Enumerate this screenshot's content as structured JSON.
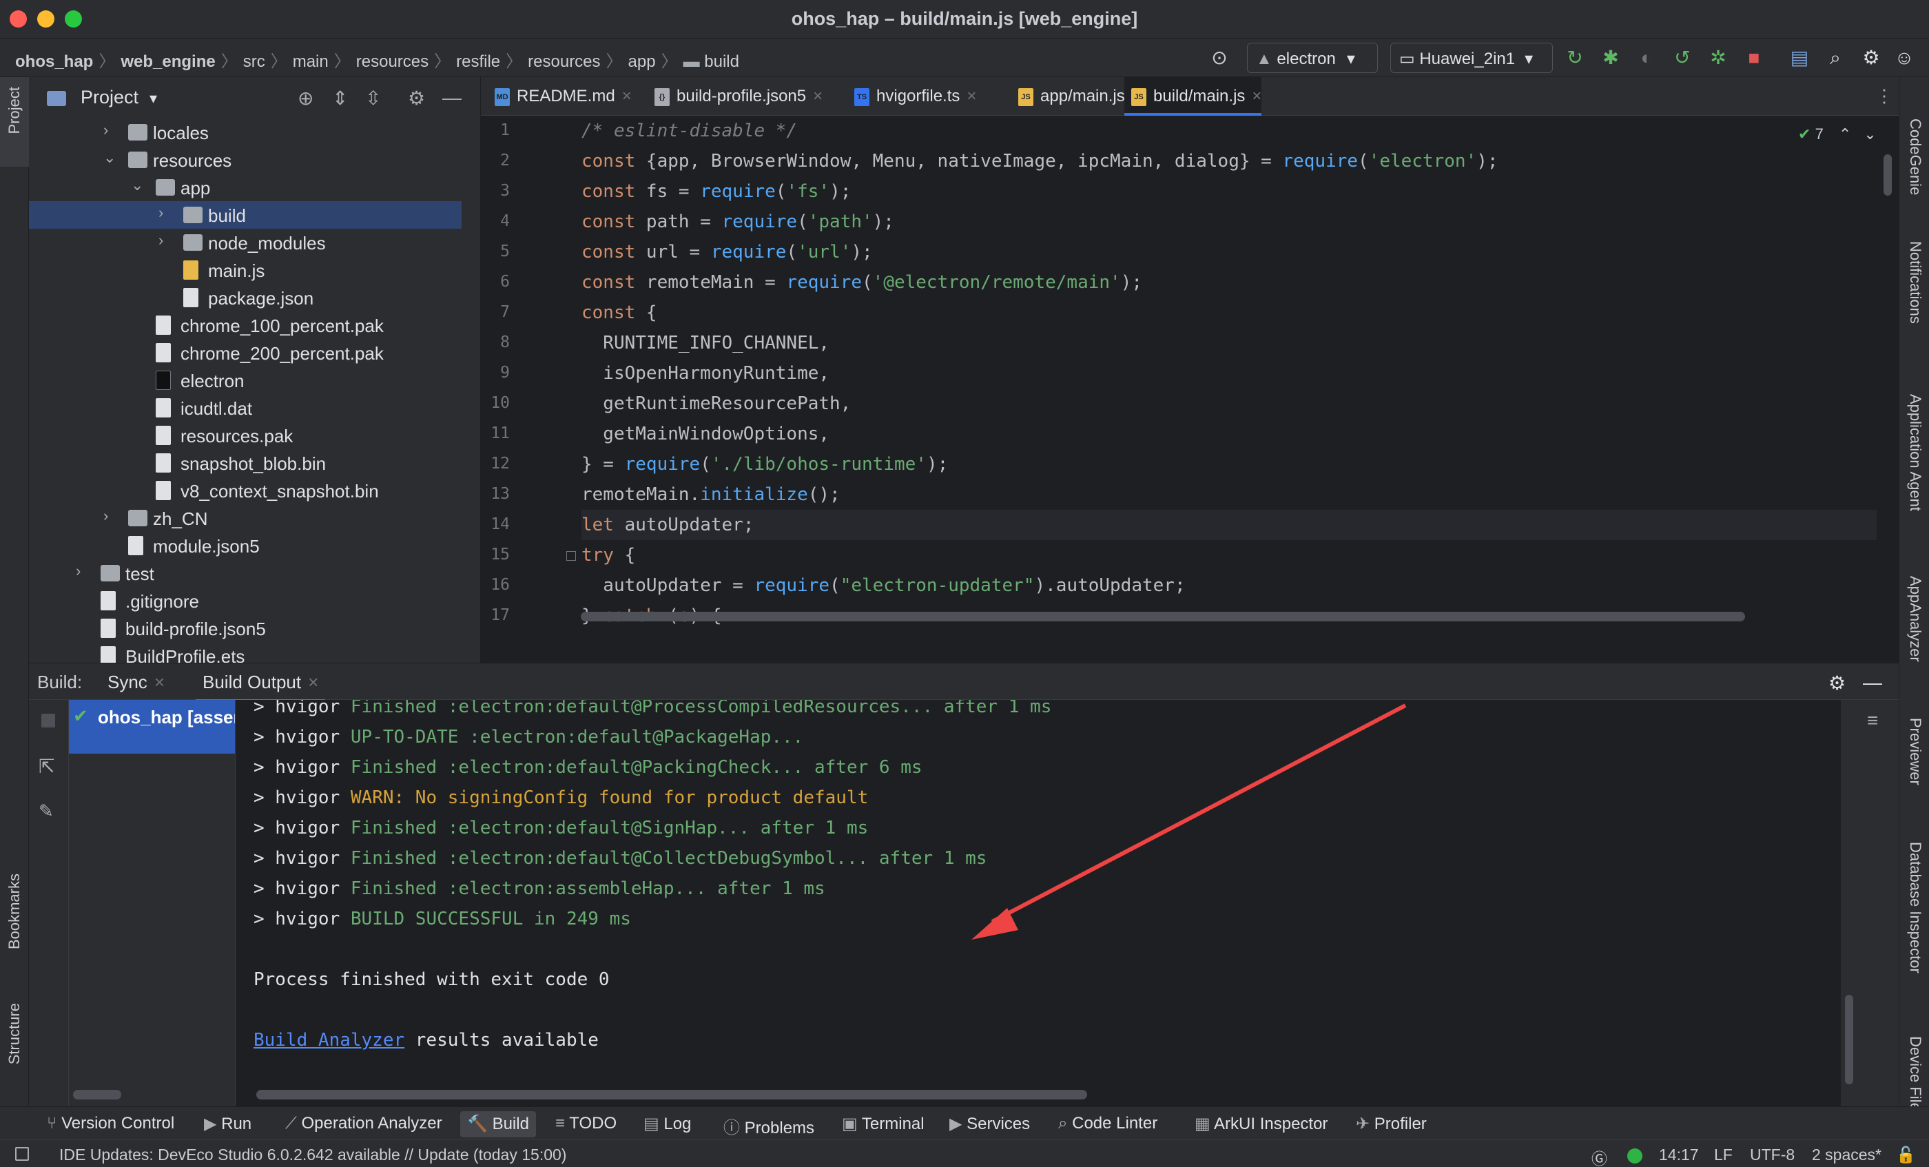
{
  "window": {
    "title": "ohos_hap – build/main.js [web_engine]"
  },
  "breadcrumb": [
    "ohos_hap",
    "web_engine",
    "src",
    "main",
    "resources",
    "resfile",
    "resources",
    "app",
    "build"
  ],
  "toolbar": {
    "run_config": "electron",
    "device": "Huawei_2in1"
  },
  "project": {
    "title": "Project",
    "tree": [
      {
        "label": "locales",
        "type": "folder",
        "depth": 2,
        "chevron": ">"
      },
      {
        "label": "resources",
        "type": "folder",
        "depth": 2,
        "chevron": "v"
      },
      {
        "label": "app",
        "type": "folder",
        "depth": 3,
        "chevron": "v"
      },
      {
        "label": "build",
        "type": "folder",
        "depth": 4,
        "chevron": ">",
        "selected": true
      },
      {
        "label": "node_modules",
        "type": "folder",
        "depth": 4,
        "chevron": ">"
      },
      {
        "label": "main.js",
        "type": "js",
        "depth": 4
      },
      {
        "label": "package.json",
        "type": "file",
        "depth": 4
      },
      {
        "label": "chrome_100_percent.pak",
        "type": "file",
        "depth": 3
      },
      {
        "label": "chrome_200_percent.pak",
        "type": "file",
        "depth": 3
      },
      {
        "label": "electron",
        "type": "exec",
        "depth": 3
      },
      {
        "label": "icudtl.dat",
        "type": "file",
        "depth": 3
      },
      {
        "label": "resources.pak",
        "type": "file",
        "depth": 3
      },
      {
        "label": "snapshot_blob.bin",
        "type": "file",
        "depth": 3
      },
      {
        "label": "v8_context_snapshot.bin",
        "type": "file",
        "depth": 3
      },
      {
        "label": "zh_CN",
        "type": "folder",
        "depth": 2,
        "chevron": ">"
      },
      {
        "label": "module.json5",
        "type": "file",
        "depth": 2
      },
      {
        "label": "test",
        "type": "folder",
        "depth": 1,
        "chevron": ">"
      },
      {
        "label": ".gitignore",
        "type": "file",
        "depth": 1
      },
      {
        "label": "build-profile.json5",
        "type": "file",
        "depth": 1
      },
      {
        "label": "BuildProfile.ets",
        "type": "file",
        "depth": 1
      }
    ]
  },
  "editor": {
    "tabs": [
      {
        "label": "README.md",
        "icon": "MD",
        "color": "#4e8ed8"
      },
      {
        "label": "build-profile.json5",
        "icon": "{}",
        "color": "#a8abb2"
      },
      {
        "label": "hvigorfile.ts",
        "icon": "TS",
        "color": "#3574f0"
      },
      {
        "label": "app/main.js",
        "icon": "JS",
        "color": "#e8b84a"
      },
      {
        "label": "build/main.js",
        "icon": "JS",
        "color": "#e8b84a",
        "active": true
      }
    ],
    "inspection_count": "7",
    "line_numbers": [
      "1",
      "2",
      "3",
      "4",
      "5",
      "6",
      "7",
      "8",
      "9",
      "10",
      "11",
      "12",
      "13",
      "14",
      "15",
      "16",
      "17"
    ],
    "lines": [
      [
        [
          "cm",
          "/* eslint-disable */"
        ]
      ],
      [
        [
          "kw",
          "const "
        ],
        [
          "pu",
          "{app, BrowserWindow, Menu, nativeImage, ipcMain, dialog} = "
        ],
        [
          "fn",
          "require"
        ],
        [
          "pu",
          "("
        ],
        [
          "str",
          "'electron'"
        ],
        [
          "pu",
          ");"
        ]
      ],
      [
        [
          "kw",
          "const "
        ],
        [
          "pu",
          "fs = "
        ],
        [
          "fn",
          "require"
        ],
        [
          "pu",
          "("
        ],
        [
          "str",
          "'fs'"
        ],
        [
          "pu",
          ");"
        ]
      ],
      [
        [
          "kw",
          "const "
        ],
        [
          "pu",
          "path = "
        ],
        [
          "fn",
          "require"
        ],
        [
          "pu",
          "("
        ],
        [
          "str",
          "'path'"
        ],
        [
          "pu",
          ");"
        ]
      ],
      [
        [
          "kw",
          "const "
        ],
        [
          "pu",
          "url = "
        ],
        [
          "fn",
          "require"
        ],
        [
          "pu",
          "("
        ],
        [
          "str",
          "'url'"
        ],
        [
          "pu",
          ");"
        ]
      ],
      [
        [
          "kw",
          "const "
        ],
        [
          "pu",
          "remoteMain = "
        ],
        [
          "fn",
          "require"
        ],
        [
          "pu",
          "("
        ],
        [
          "str",
          "'@electron/remote/main'"
        ],
        [
          "pu",
          ");"
        ]
      ],
      [
        [
          "kw",
          "const "
        ],
        [
          "pu",
          "{"
        ]
      ],
      [
        [
          "pu",
          "  RUNTIME_INFO_CHANNEL,"
        ]
      ],
      [
        [
          "pu",
          "  isOpenHarmonyRuntime,"
        ]
      ],
      [
        [
          "pu",
          "  getRuntimeResourcePath,"
        ]
      ],
      [
        [
          "pu",
          "  getMainWindowOptions,"
        ]
      ],
      [
        [
          "pu",
          "} = "
        ],
        [
          "fn",
          "require"
        ],
        [
          "pu",
          "("
        ],
        [
          "str",
          "'./lib/ohos-runtime'"
        ],
        [
          "pu",
          ");"
        ]
      ],
      [
        [
          "pu",
          "remoteMain."
        ],
        [
          "fn",
          "initialize"
        ],
        [
          "pu",
          "();"
        ]
      ],
      [
        [
          "kw",
          "let "
        ],
        [
          "pu",
          "autoUpdater;"
        ]
      ],
      [
        [
          "kw",
          "try "
        ],
        [
          "pu",
          "{"
        ]
      ],
      [
        [
          "pu",
          "  autoUpdater = "
        ],
        [
          "fn",
          "require"
        ],
        [
          "pu",
          "("
        ],
        [
          "str",
          "\"electron-updater\""
        ],
        [
          "pu",
          ").autoUpdater;"
        ]
      ],
      [
        [
          "pu",
          "} "
        ],
        [
          "kw",
          "catch "
        ],
        [
          "pu",
          "(e) {"
        ]
      ]
    ]
  },
  "build": {
    "label": "Build:",
    "tabs": [
      "Sync",
      "Build Output"
    ],
    "node": "ohos_hap [assembleHap]",
    "output": [
      [
        [
          "",
          "> hvigor "
        ],
        [
          "og",
          "Finished :electron:default@ProcessCompiledResources... after 1 ms"
        ]
      ],
      [
        [
          "",
          "> hvigor "
        ],
        [
          "og",
          "UP-TO-DATE :electron:default@PackageHap..."
        ]
      ],
      [
        [
          "",
          "> hvigor "
        ],
        [
          "og",
          "Finished :electron:default@PackingCheck... after 6 ms"
        ]
      ],
      [
        [
          "",
          "> hvigor "
        ],
        [
          "ow",
          "WARN: No signingConfig found for product default"
        ]
      ],
      [
        [
          "",
          "> hvigor "
        ],
        [
          "og",
          "Finished :electron:default@SignHap... after 1 ms"
        ]
      ],
      [
        [
          "",
          "> hvigor "
        ],
        [
          "og",
          "Finished :electron:default@CollectDebugSymbol... after 1 ms"
        ]
      ],
      [
        [
          "",
          "> hvigor "
        ],
        [
          "og",
          "Finished :electron:assembleHap... after 1 ms"
        ]
      ],
      [
        [
          "",
          "> hvigor "
        ],
        [
          "og",
          "BUILD SUCCESSFUL in 249 ms"
        ]
      ],
      [
        [
          "",
          ""
        ]
      ],
      [
        [
          "",
          "Process finished with exit code 0"
        ]
      ],
      [
        [
          "",
          ""
        ]
      ],
      [
        [
          "olink",
          "Build Analyzer"
        ],
        [
          "",
          " results available"
        ]
      ]
    ]
  },
  "left_strip": {
    "project": "Project",
    "bookmarks": "Bookmarks",
    "structure": "Structure"
  },
  "right_strip": [
    "CodeGenie",
    "Notifications",
    "Application Agent",
    "AppAnalyzer",
    "Previewer",
    "Database Inspector",
    "Device File"
  ],
  "bottom_tools": [
    "Version Control",
    "Run",
    "Operation Analyzer",
    "Build",
    "TODO",
    "Log",
    "Problems",
    "Terminal",
    "Services",
    "Code Linter",
    "ArkUI Inspector",
    "Profiler"
  ],
  "status": {
    "message": "IDE Updates: DevEco Studio 6.0.2.642 available // Update (today 15:00)",
    "position": "14:17",
    "line_sep": "LF",
    "encoding": "UTF-8",
    "indent": "2 spaces*"
  }
}
